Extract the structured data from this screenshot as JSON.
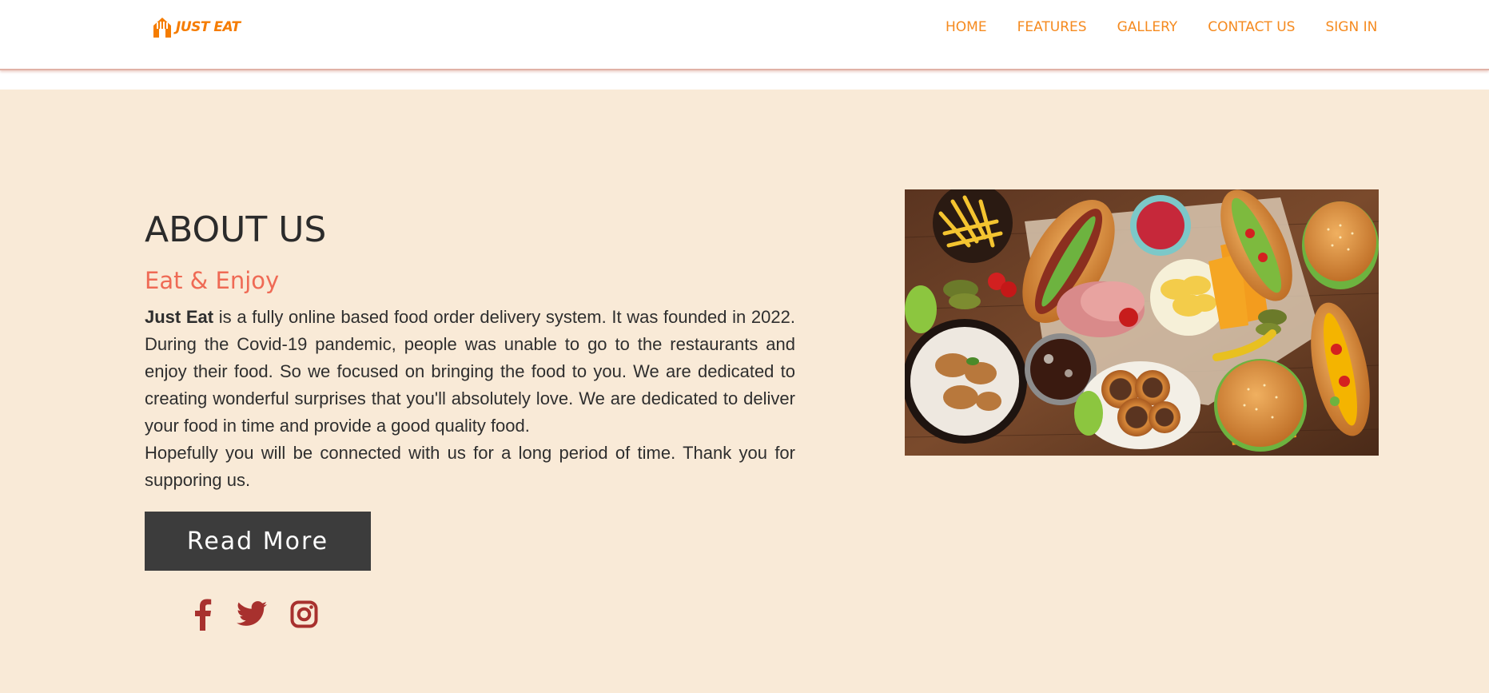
{
  "brand": {
    "name": "JUST EAT",
    "color": "#f57c00"
  },
  "nav": {
    "items": [
      "HOME",
      "FEATURES",
      "GALLERY",
      "CONTACT US",
      "SIGN IN"
    ],
    "color": "#f58a1f"
  },
  "about": {
    "title": "ABOUT US",
    "subtitle": "Eat & Enjoy",
    "brand_strong": "Just Eat",
    "paragraph1": " is a fully online based food order delivery system. It was founded in 2022. During the Covid-19 pandemic, people was unable to go to the restaurants and enjoy their food. So we focused on bringing the food to you. We are dedicated to creating wonderful surprises that you'll absolutely love. We are dedicated to deliver your food in time and provide a good quality food.",
    "paragraph2": "Hopefully you will be connected with us for a long period of time. Thank you for supporing us.",
    "read_more_label": "Read More",
    "background": "#f9ead7",
    "subtitle_color": "#ef6a55"
  },
  "social": {
    "icons": [
      "facebook-icon",
      "twitter-icon",
      "instagram-icon"
    ],
    "color": "#a8312e"
  },
  "hero_image": {
    "subject": "food-spread-photo"
  }
}
